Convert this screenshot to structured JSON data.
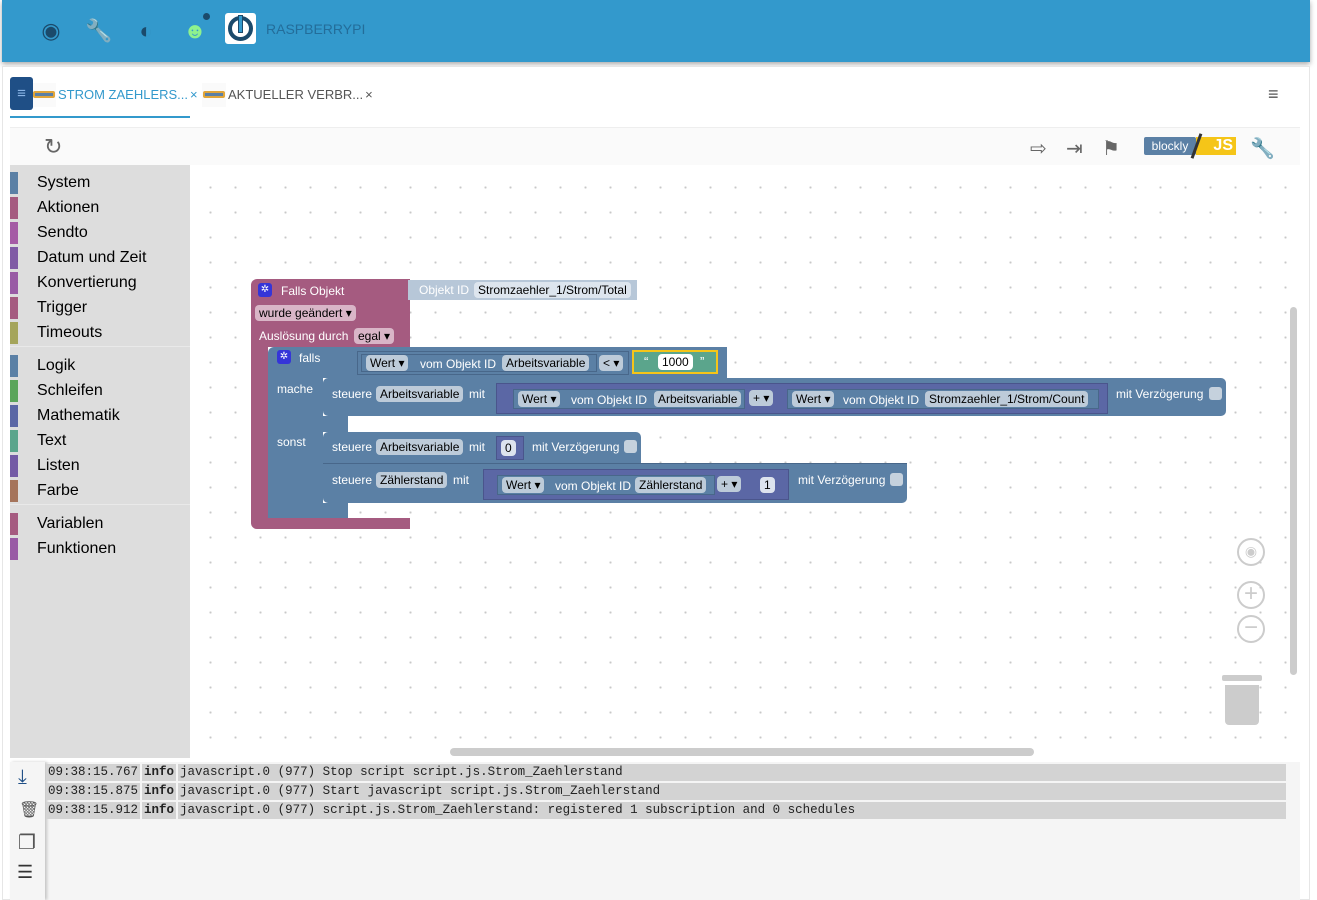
{
  "header": {
    "host": "RASPBERRYPI",
    "icons": [
      "eye-icon",
      "wrench-icon",
      "brightness-icon",
      "head-icon",
      "iobroker-logo"
    ]
  },
  "tabs": [
    {
      "label": "STROM ZAEHLERS...",
      "close": "×",
      "active": true
    },
    {
      "label": "AKTUELLER VERBR...",
      "close": "×",
      "active": false
    }
  ],
  "toolbar": {
    "blockly": "blockly",
    "js": "JS",
    "icons": [
      "export-icon",
      "import-icon",
      "checkered-flag-icon",
      "blockly-js-toggle",
      "wrench-icon",
      "refresh-icon"
    ]
  },
  "sidebar": {
    "groups": [
      [
        {
          "label": "System",
          "color": "#5b80a5"
        },
        {
          "label": "Aktionen",
          "color": "#a55b80"
        },
        {
          "label": "Sendto",
          "color": "#a55ba5"
        },
        {
          "label": "Datum und Zeit",
          "color": "#805ba5"
        },
        {
          "label": "Konvertierung",
          "color": "#995ba5"
        },
        {
          "label": "Trigger",
          "color": "#a55b80"
        },
        {
          "label": "Timeouts",
          "color": "#a5a55b"
        }
      ],
      [
        {
          "label": "Logik",
          "color": "#5b80a5"
        },
        {
          "label": "Schleifen",
          "color": "#5ba55b"
        },
        {
          "label": "Mathematik",
          "color": "#5b67a5"
        },
        {
          "label": "Text",
          "color": "#5ba58c"
        },
        {
          "label": "Listen",
          "color": "#745ba5"
        },
        {
          "label": "Farbe",
          "color": "#a5745b"
        }
      ],
      [
        {
          "label": "Variablen",
          "color": "#a55b80"
        },
        {
          "label": "Funktionen",
          "color": "#995ba5"
        }
      ]
    ]
  },
  "blocks": {
    "event": {
      "title": "Falls Objekt",
      "objid_label": "Objekt ID",
      "objid": "Stromzaehler_1/Strom/Total",
      "mode": "wurde geändert",
      "trigger_label": "Auslösung durch",
      "trigger": "egal"
    },
    "if": {
      "falls": "falls",
      "mache": "mache",
      "sonst": "sonst",
      "cond": {
        "wert": "Wert",
        "vom": "vom Objekt ID",
        "obj": "Arbeitsvariable",
        "op": "<",
        "value": "1000"
      }
    },
    "set1": {
      "steuere": "steuere",
      "target": "Arbeitsvariable",
      "mit": "mit",
      "a_wert": "Wert",
      "a_vom": "vom Objekt ID",
      "a_obj": "Arbeitsvariable",
      "op": "+",
      "b_wert": "Wert",
      "b_vom": "vom Objekt ID",
      "b_obj": "Stromzaehler_1/Strom/Count",
      "delay": "mit Verzögerung"
    },
    "set2": {
      "steuere": "steuere",
      "target": "Arbeitsvariable",
      "mit": "mit",
      "value": "0",
      "delay": "mit Verzögerung"
    },
    "set3": {
      "steuere": "steuere",
      "target": "Zählerstand",
      "mit": "mit",
      "wert": "Wert",
      "vom": "vom Objekt ID",
      "obj": "Zählerstand",
      "op": "+",
      "value": "1",
      "delay": "mit Verzögerung"
    }
  },
  "log": [
    {
      "time": "09:38:15.767",
      "level": "info",
      "source": "javascript.0",
      "pid": "(977)",
      "msg": "Stop script script.js.Strom_Zaehlerstand"
    },
    {
      "time": "09:38:15.875",
      "level": "info",
      "source": "javascript.0",
      "pid": "(977)",
      "msg": "Start javascript script.js.Strom_Zaehlerstand"
    },
    {
      "time": "09:38:15.912",
      "level": "info",
      "source": "javascript.0",
      "pid": "(977)",
      "msg": "script.js.Strom_Zaehlerstand: registered 1 subscription and 0 schedules"
    }
  ],
  "colors": {
    "header": "#3399cc",
    "event_block": "#a55b80",
    "logic_block": "#5b80a5",
    "math_block": "#5b67a5",
    "text_block": "#5ba58c"
  }
}
